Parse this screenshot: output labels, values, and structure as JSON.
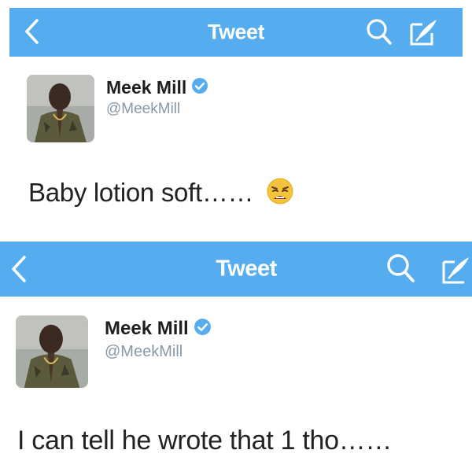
{
  "tweets": [
    {
      "nav_title": "Tweet",
      "name": "Meek Mill",
      "handle": "@MeekMill",
      "text": "Baby lotion soft……",
      "emoji": "weary-face-emoji"
    },
    {
      "nav_title": "Tweet",
      "name": "Meek Mill",
      "handle": "@MeekMill",
      "text": "I can tell he wrote that 1 tho……"
    }
  ],
  "colors": {
    "nav_bg": "#55acee",
    "verified": "#55acee",
    "handle": "#8899a6"
  },
  "icons": [
    "back-icon",
    "search-icon",
    "compose-icon",
    "verified-badge-icon"
  ]
}
